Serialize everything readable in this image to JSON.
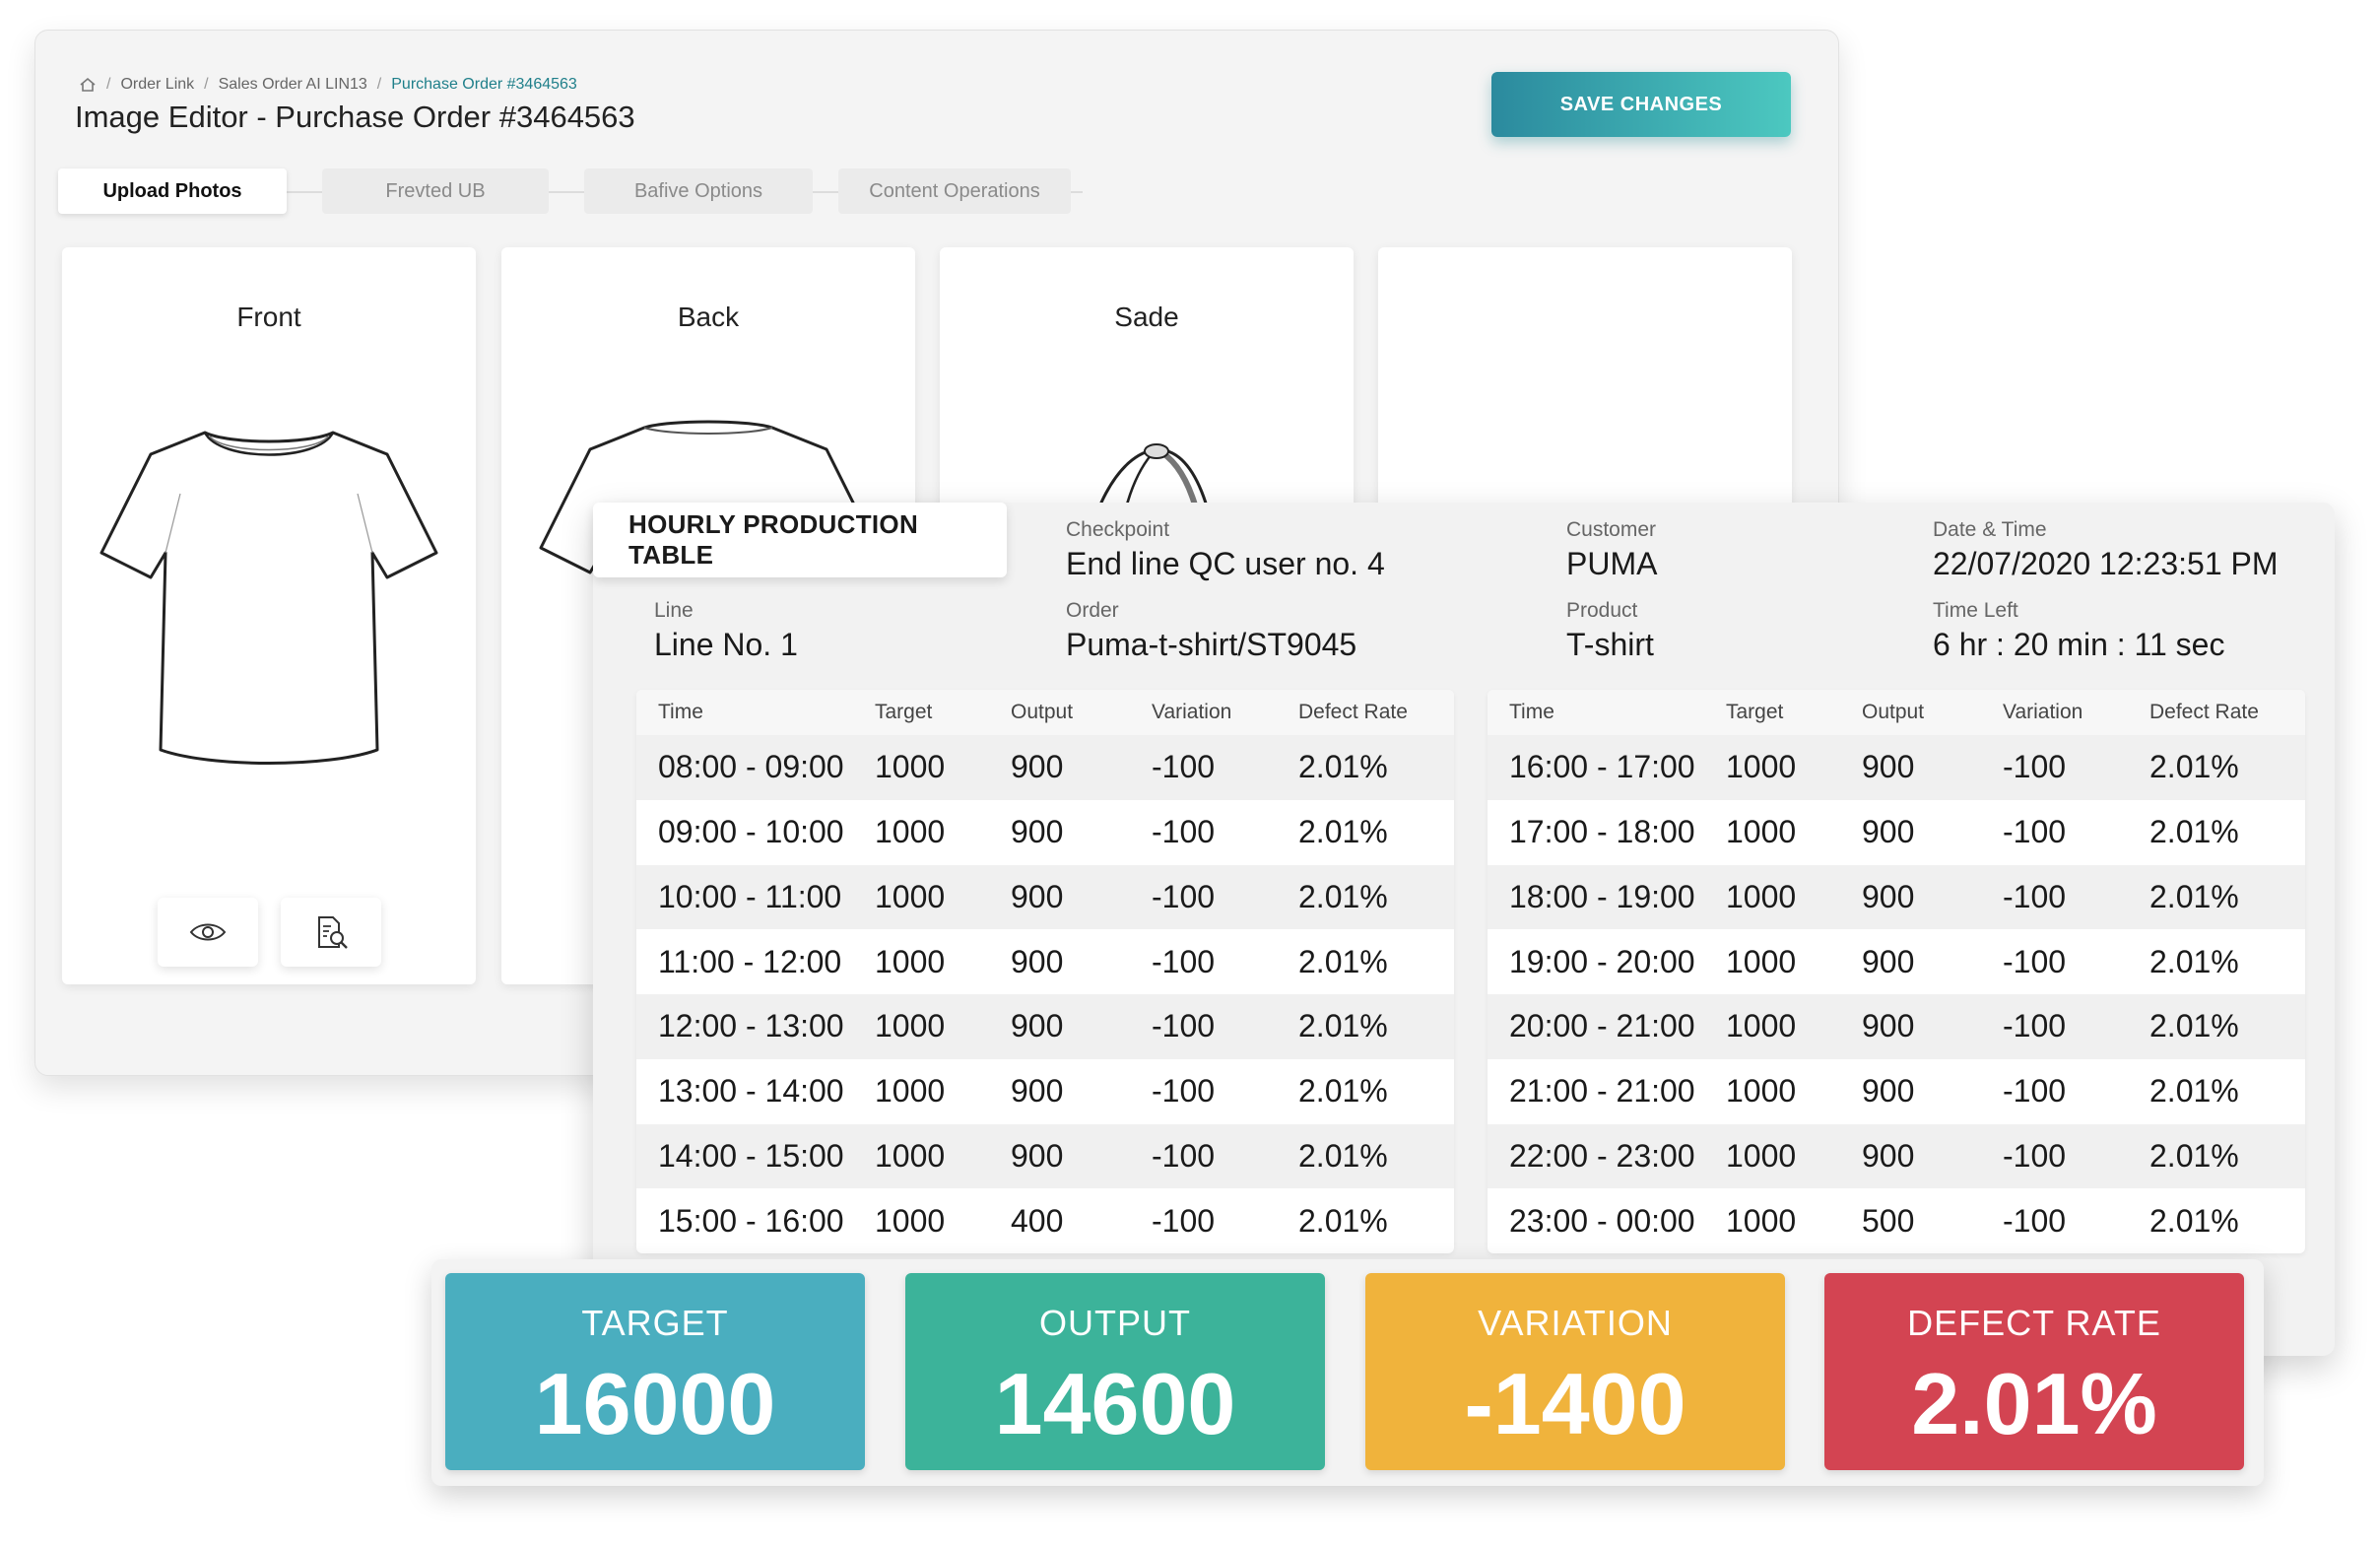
{
  "editor": {
    "breadcrumb": [
      "Order Link",
      "Sales Order AI LIN13",
      "Purchase Order #3464563"
    ],
    "title": "Image Editor - Purchase Order #3464563",
    "save_label": "SAVE CHANGES",
    "tabs": [
      "Upload Photos",
      "Frevted UB",
      "Bafive Options",
      "Content Operations"
    ],
    "photos": [
      "Front",
      "Back",
      "Sade"
    ]
  },
  "production": {
    "title": "HOURLY PRODUCTION TABLE",
    "checkpoint_label": "Checkpoint",
    "checkpoint": "End line QC user no. 4",
    "customer_label": "Customer",
    "customer": "PUMA",
    "datetime_label": "Date & Time",
    "datetime": "22/07/2020 12:23:51 PM",
    "line_label": "Line",
    "line": "Line No. 1",
    "order_label": "Order",
    "order": "Puma-t-shirt/ST9045",
    "product_label": "Product",
    "product": "T-shirt",
    "time_left_label": "Time Left",
    "time_left": "6 hr : 20 min : 11 sec",
    "columns": [
      "Time",
      "Target",
      "Output",
      "Variation",
      "Defect Rate"
    ],
    "left_rows": [
      [
        "08:00 - 09:00",
        "1000",
        "900",
        "-100",
        "2.01%"
      ],
      [
        "09:00 - 10:00",
        "1000",
        "900",
        "-100",
        "2.01%"
      ],
      [
        "10:00 - 11:00",
        "1000",
        "900",
        "-100",
        "2.01%"
      ],
      [
        "11:00 - 12:00",
        "1000",
        "900",
        "-100",
        "2.01%"
      ],
      [
        "12:00 - 13:00",
        "1000",
        "900",
        "-100",
        "2.01%"
      ],
      [
        "13:00 - 14:00",
        "1000",
        "900",
        "-100",
        "2.01%"
      ],
      [
        "14:00 - 15:00",
        "1000",
        "900",
        "-100",
        "2.01%"
      ],
      [
        "15:00 - 16:00",
        "1000",
        "400",
        "-100",
        "2.01%"
      ]
    ],
    "right_rows": [
      [
        "16:00 - 17:00",
        "1000",
        "900",
        "-100",
        "2.01%"
      ],
      [
        "17:00 - 18:00",
        "1000",
        "900",
        "-100",
        "2.01%"
      ],
      [
        "18:00 - 19:00",
        "1000",
        "900",
        "-100",
        "2.01%"
      ],
      [
        "19:00 - 20:00",
        "1000",
        "900",
        "-100",
        "2.01%"
      ],
      [
        "20:00 - 21:00",
        "1000",
        "900",
        "-100",
        "2.01%"
      ],
      [
        "21:00 - 21:00",
        "1000",
        "900",
        "-100",
        "2.01%"
      ],
      [
        "22:00 - 23:00",
        "1000",
        "900",
        "-100",
        "2.01%"
      ],
      [
        "23:00 - 00:00",
        "1000",
        "500",
        "-100",
        "2.01%"
      ]
    ]
  },
  "kpis": [
    {
      "label": "TARGET",
      "value": "16000",
      "color": "#4aaebf"
    },
    {
      "label": "OUTPUT",
      "value": "14600",
      "color": "#3cb39a"
    },
    {
      "label": "VARIATION",
      "value": "-1400",
      "color": "#f0b33c"
    },
    {
      "label": "DEFECT RATE",
      "value": "2.01%",
      "color": "#d34452"
    }
  ]
}
